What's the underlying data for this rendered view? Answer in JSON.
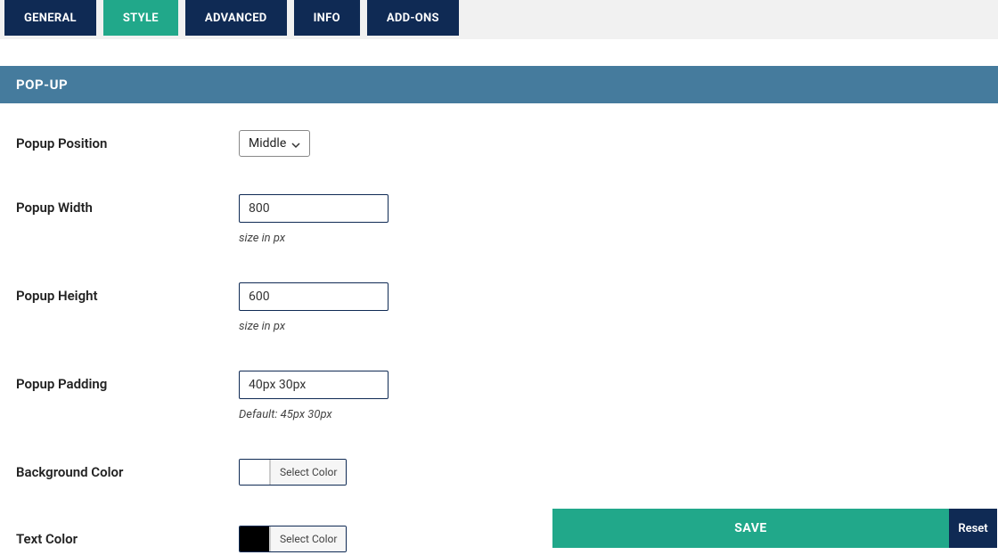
{
  "tabs": {
    "general": "GENERAL",
    "style": "STYLE",
    "advanced": "ADVANCED",
    "info": "INFO",
    "addons": "ADD-ONS"
  },
  "section_title": "POP-UP",
  "fields": {
    "position": {
      "label": "Popup Position",
      "value": "Middle"
    },
    "width": {
      "label": "Popup Width",
      "value": "800",
      "hint": "size in px"
    },
    "height": {
      "label": "Popup Height",
      "value": "600",
      "hint": "size in px"
    },
    "padding": {
      "label": "Popup Padding",
      "value": "40px 30px",
      "hint": "Default: 45px 30px"
    },
    "bgcolor": {
      "label": "Background Color",
      "button": "Select Color"
    },
    "textcolor": {
      "label": "Text Color",
      "button": "Select Color"
    }
  },
  "footer": {
    "save": "SAVE",
    "reset": "Reset"
  }
}
